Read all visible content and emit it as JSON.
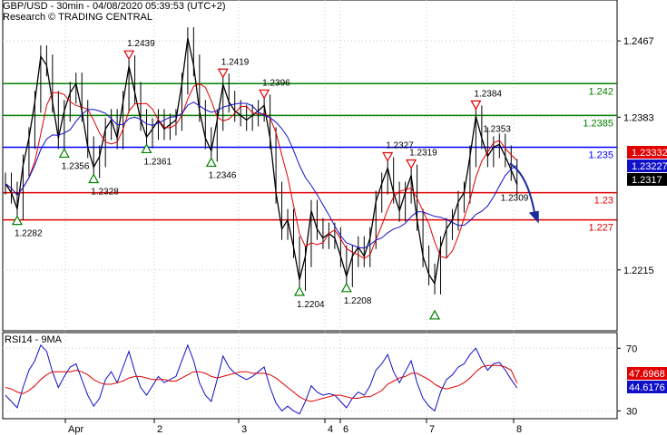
{
  "header": {
    "title": "GBP/USD - 30min - 04/08/2020 05:39:53 (UTC+2)",
    "subtitle": "Research © TRADING CENTRAL"
  },
  "colors": {
    "price": "#000000",
    "ma_fast": "#e00000",
    "ma_slow": "#1010c8",
    "resistance": "#008000",
    "pivot": "#0000ff",
    "support": "#e00000",
    "grid": "#c8c8c8",
    "arrow": "#1a2a9a",
    "up_marker": "#008000",
    "down_marker": "#e00000"
  },
  "chart_data": [
    {
      "type": "candlestick",
      "instrument": "GBP/USD",
      "timeframe": "30min",
      "ylim": [
        1.2148,
        1.2512
      ],
      "yticks": [
        1.2467,
        1.2383,
        1.2215
      ],
      "x_labels": [
        "Apr",
        "2",
        "3",
        "4",
        "6",
        "7",
        "8"
      ],
      "price_close_series": [
        1.231,
        1.23,
        1.2282,
        1.233,
        1.236,
        1.24,
        1.245,
        1.244,
        1.24,
        1.236,
        1.239,
        1.241,
        1.242,
        1.239,
        1.235,
        1.2328,
        1.234,
        1.237,
        1.238,
        1.236,
        1.24,
        1.2439,
        1.241,
        1.238,
        1.2361,
        1.237,
        1.238,
        1.237,
        1.2375,
        1.238,
        1.242,
        1.247,
        1.244,
        1.239,
        1.236,
        1.2346,
        1.238,
        1.2419,
        1.24,
        1.239,
        1.2385,
        1.238,
        1.2385,
        1.239,
        1.2396,
        1.236,
        1.23,
        1.226,
        1.227,
        1.224,
        1.2204,
        1.223,
        1.228,
        1.226,
        1.225,
        1.2255,
        1.225,
        1.223,
        1.2208,
        1.223,
        1.224,
        1.223,
        1.225,
        1.229,
        1.231,
        1.2327,
        1.23,
        1.228,
        1.23,
        1.2319,
        1.227,
        1.223,
        1.221,
        1.22,
        1.224,
        1.226,
        1.227,
        1.229,
        1.23,
        1.234,
        1.2384,
        1.236,
        1.234,
        1.235,
        1.2353,
        1.234,
        1.2325,
        1.2309
      ],
      "levels": [
        {
          "value": 1.242,
          "label": "1.242",
          "kind": "resistance"
        },
        {
          "value": 1.2385,
          "label": "1.2385",
          "kind": "resistance"
        },
        {
          "value": 1.235,
          "label": "1.235",
          "kind": "pivot"
        },
        {
          "value": 1.23,
          "label": "1.23",
          "kind": "support"
        },
        {
          "value": 1.227,
          "label": "1.227",
          "kind": "support"
        }
      ],
      "price_tags": [
        {
          "value": 1.2333,
          "label": "1.23332",
          "kind": "ma_fast"
        },
        {
          "value": 1.2323,
          "label": "1.23227",
          "kind": "ma_slow"
        },
        {
          "value": 1.2317,
          "label": "1.2317",
          "kind": "last"
        }
      ],
      "annotations": [
        {
          "i": 2,
          "value": 1.2282,
          "label": "1.2282",
          "dir": "low"
        },
        {
          "i": 10,
          "value": 1.2356,
          "label": "1.2356",
          "dir": "low"
        },
        {
          "i": 15,
          "value": 1.2328,
          "label": "1.2328",
          "dir": "low"
        },
        {
          "i": 21,
          "value": 1.2439,
          "label": "1.2439",
          "dir": "high"
        },
        {
          "i": 24,
          "value": 1.2361,
          "label": "1.2361",
          "dir": "low"
        },
        {
          "i": 35,
          "value": 1.2346,
          "label": "1.2346",
          "dir": "low"
        },
        {
          "i": 37,
          "value": 1.2419,
          "label": "1.2419",
          "dir": "high"
        },
        {
          "i": 44,
          "value": 1.2396,
          "label": "1.2396",
          "dir": "high"
        },
        {
          "i": 50,
          "value": 1.2204,
          "label": "1.2204",
          "dir": "low"
        },
        {
          "i": 58,
          "value": 1.2208,
          "label": "1.2208",
          "dir": "low"
        },
        {
          "i": 65,
          "value": 1.2327,
          "label": "1.2327",
          "dir": "high"
        },
        {
          "i": 69,
          "value": 1.2319,
          "label": "1.2319",
          "dir": "high"
        },
        {
          "i": 73,
          "value": 1.2178,
          "label": "",
          "dir": "low"
        },
        {
          "i": 80,
          "value": 1.2384,
          "label": "1.2384",
          "dir": "high"
        },
        {
          "i": 84,
          "value": 1.2353,
          "label": "1.2353",
          "dir": "none"
        },
        {
          "i": 87,
          "value": 1.2309,
          "label": "1.2309",
          "dir": "none"
        }
      ],
      "projection": {
        "from": 1.232,
        "to": 1.227
      }
    },
    {
      "type": "line",
      "title": "RSI14 - 9MA",
      "ylim": [
        25,
        80
      ],
      "yticks": [
        70,
        30
      ],
      "rsi": [
        40,
        36,
        32,
        45,
        56,
        62,
        72,
        68,
        55,
        45,
        52,
        58,
        60,
        50,
        40,
        33,
        38,
        50,
        55,
        48,
        58,
        68,
        55,
        45,
        40,
        46,
        52,
        48,
        50,
        52,
        62,
        72,
        62,
        48,
        40,
        36,
        50,
        65,
        58,
        54,
        52,
        50,
        52,
        55,
        58,
        45,
        35,
        30,
        33,
        30,
        28,
        36,
        46,
        42,
        40,
        41,
        40,
        36,
        32,
        38,
        42,
        40,
        46,
        56,
        60,
        66,
        55,
        48,
        55,
        62,
        48,
        38,
        33,
        30,
        42,
        50,
        53,
        58,
        60,
        66,
        70,
        62,
        56,
        60,
        61,
        56,
        50,
        44.6
      ],
      "rsi_ma": [
        45,
        44,
        42,
        41,
        43,
        46,
        50,
        53,
        55,
        55,
        55,
        55,
        56,
        55,
        53,
        50,
        48,
        47,
        47,
        48,
        49,
        51,
        52,
        52,
        51,
        50,
        50,
        50,
        49,
        49,
        51,
        53,
        55,
        55,
        54,
        52,
        51,
        52,
        53,
        54,
        55,
        55,
        54,
        54,
        54,
        53,
        51,
        48,
        45,
        42,
        39,
        37,
        36,
        37,
        38,
        39,
        40,
        40,
        39,
        38,
        38,
        39,
        39,
        41,
        43,
        47,
        49,
        51,
        52,
        54,
        54,
        52,
        50,
        47,
        45,
        44,
        45,
        46,
        48,
        51,
        55,
        58,
        59,
        59,
        59,
        58,
        56,
        47.7
      ],
      "tags": [
        {
          "value": 47.7,
          "label": "47.6968",
          "kind": "ma_fast"
        },
        {
          "value": 44.6,
          "label": "44.6176",
          "kind": "ma_slow"
        }
      ]
    }
  ]
}
